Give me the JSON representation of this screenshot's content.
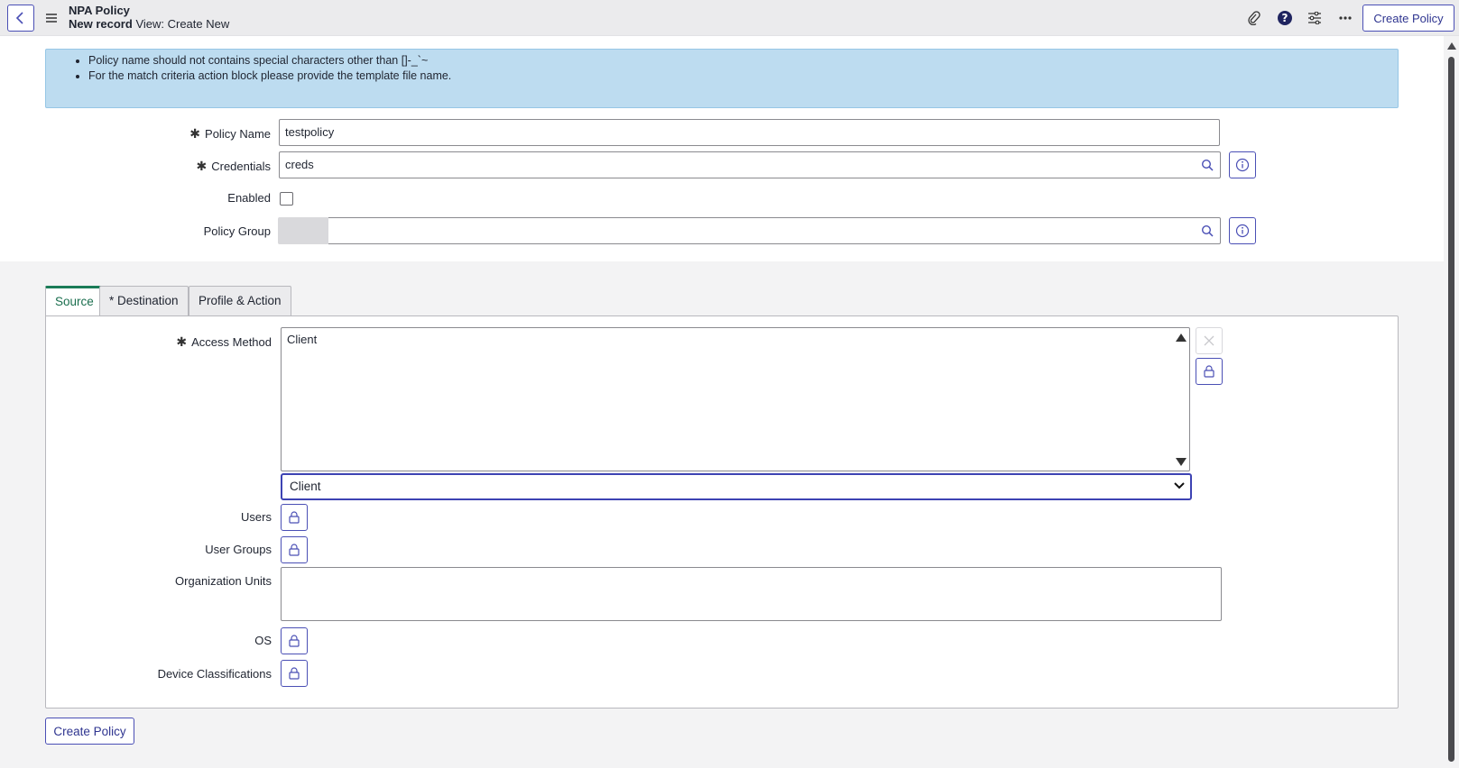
{
  "header": {
    "title": "NPA Policy",
    "record_label": "New record",
    "view_label": "View: Create New",
    "create_button": "Create Policy",
    "icons": [
      "back-icon",
      "menu-icon",
      "paperclip-icon",
      "help-icon",
      "settings-sliders-icon",
      "more-icon"
    ]
  },
  "info": {
    "messages": [
      "Policy name should not contains special characters other than []-_`~",
      "For the match criteria action block please provide the template file name."
    ]
  },
  "form": {
    "policy_name": {
      "label": "Policy Name",
      "value": "testpolicy",
      "required": true
    },
    "credentials": {
      "label": "Credentials",
      "value": "creds",
      "required": true
    },
    "enabled": {
      "label": "Enabled",
      "checked": false
    },
    "policy_group": {
      "label": "Policy Group",
      "value": ""
    }
  },
  "tabs": [
    {
      "label": "Source",
      "active": true
    },
    {
      "label": "* Destination",
      "active": false
    },
    {
      "label": "Profile & Action",
      "active": false
    }
  ],
  "source": {
    "access_method": {
      "label": "Access Method",
      "required": true,
      "list_items": [
        "Client"
      ],
      "selected": "Client"
    },
    "users": {
      "label": "Users"
    },
    "user_groups": {
      "label": "User Groups"
    },
    "organization_units": {
      "label": "Organization Units",
      "value": ""
    },
    "os": {
      "label": "OS"
    },
    "device_classifications": {
      "label": "Device Classifications"
    }
  },
  "footer": {
    "create_button": "Create Policy"
  },
  "colors": {
    "accent": "#4a4fb5",
    "active_tab": "#1a7b57",
    "info_bg": "#bddcf0"
  }
}
